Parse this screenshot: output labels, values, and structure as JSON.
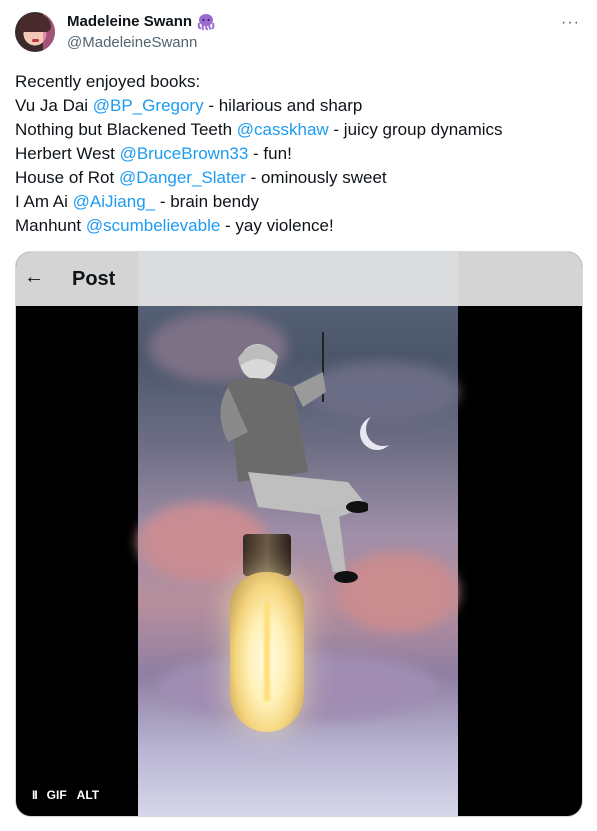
{
  "author": {
    "display_name": "Madeleine Swann",
    "handle": "@MadeleineSwann"
  },
  "more_label": "···",
  "tweet": {
    "intro": "Recently enjoyed books:",
    "lines": [
      {
        "before": "Vu Ja Dai ",
        "mention": "@BP_Gregory",
        "after": " - hilarious and sharp"
      },
      {
        "before": "Nothing but Blackened Teeth ",
        "mention": "@casskhaw",
        "after": " - juicy group dynamics"
      },
      {
        "before": "Herbert West ",
        "mention": "@BruceBrown33",
        "after": " - fun!"
      },
      {
        "before": "House of Rot ",
        "mention": "@Danger_Slater",
        "after": " - ominously sweet"
      },
      {
        "before": "I Am Ai ",
        "mention": "@AiJiang_",
        "after": " - brain bendy"
      },
      {
        "before": "Manhunt ",
        "mention": "@scumbelievable",
        "after": " - yay violence!"
      }
    ]
  },
  "media": {
    "back_icon": "←",
    "title": "Post",
    "pause_icon": "II",
    "gif_label": "GIF",
    "alt_label": "ALT"
  },
  "colors": {
    "link": "#1d9bf0",
    "muted": "#536471"
  }
}
